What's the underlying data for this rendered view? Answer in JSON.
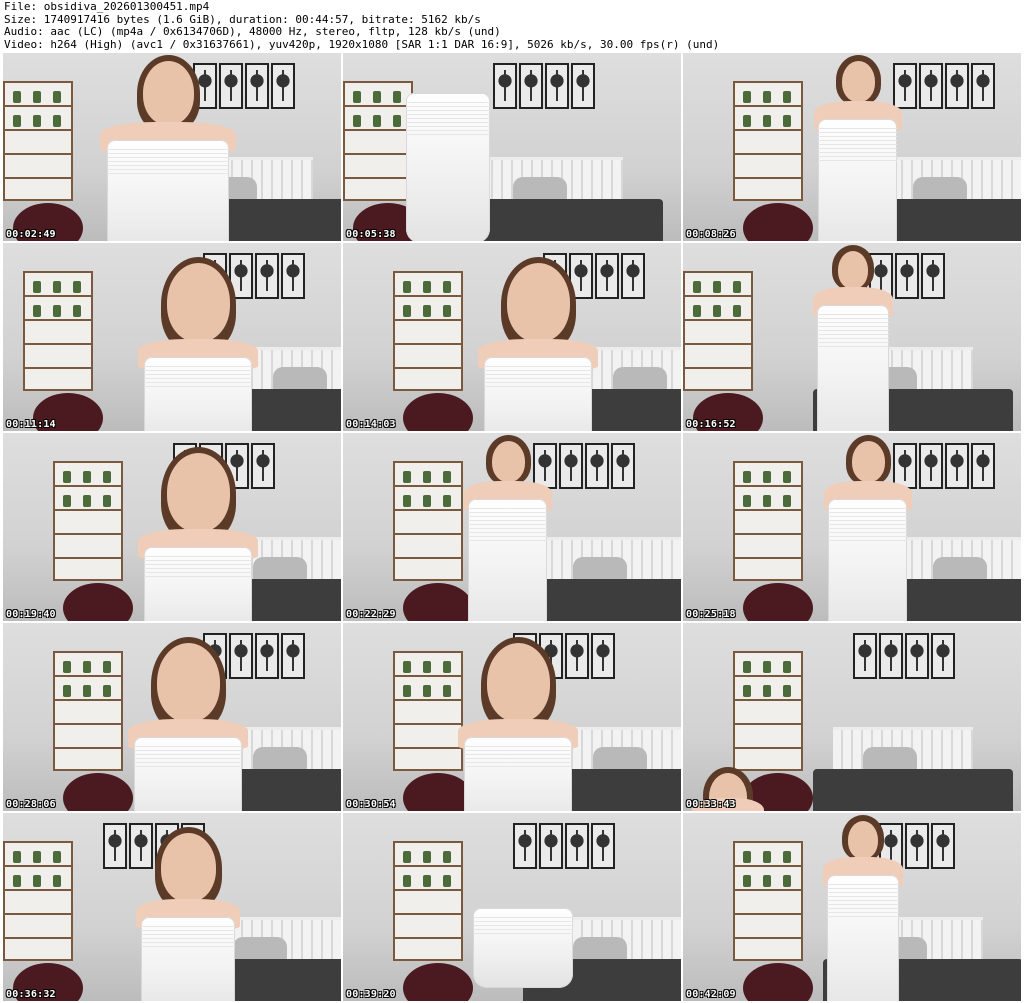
{
  "header": {
    "file_line": "File: obsidiva_202601300451.mp4",
    "size_line": "Size: 1740917416 bytes (1.6 GiB), duration: 00:44:57, bitrate: 5162 kb/s",
    "audio_line": "Audio: aac (LC) (mp4a / 0x6134706D), 48000 Hz, stereo, fltp, 128 kb/s (und)",
    "video_line": "Video: h264 (High) (avc1 / 0x31637661), yuv420p, 1920x1080 [SAR 1:1 DAR 16:9], 5026 kb/s, 30.00 fps(r) (und)"
  },
  "thumbnails": [
    {
      "timestamp": "00:02:49"
    },
    {
      "timestamp": "00:05:38"
    },
    {
      "timestamp": "00:08:26"
    },
    {
      "timestamp": "00:11:14"
    },
    {
      "timestamp": "00:14:03"
    },
    {
      "timestamp": "00:16:52"
    },
    {
      "timestamp": "00:19:40"
    },
    {
      "timestamp": "00:22:29"
    },
    {
      "timestamp": "00:25:18"
    },
    {
      "timestamp": "00:28:06"
    },
    {
      "timestamp": "00:30:54"
    },
    {
      "timestamp": "00:33:43"
    },
    {
      "timestamp": "00:36:32"
    },
    {
      "timestamp": "00:39:20"
    },
    {
      "timestamp": "00:42:09"
    }
  ],
  "colors": {
    "wall": "#d6d6d6",
    "shelf_wood": "#7a5a3f",
    "dress": "#ffffff",
    "skin": "#efcdb8",
    "hair": "#5b3a28",
    "bedding": "#3d3d3d",
    "pouf": "#4b1a20",
    "timestamp_text": "#ffffff"
  }
}
